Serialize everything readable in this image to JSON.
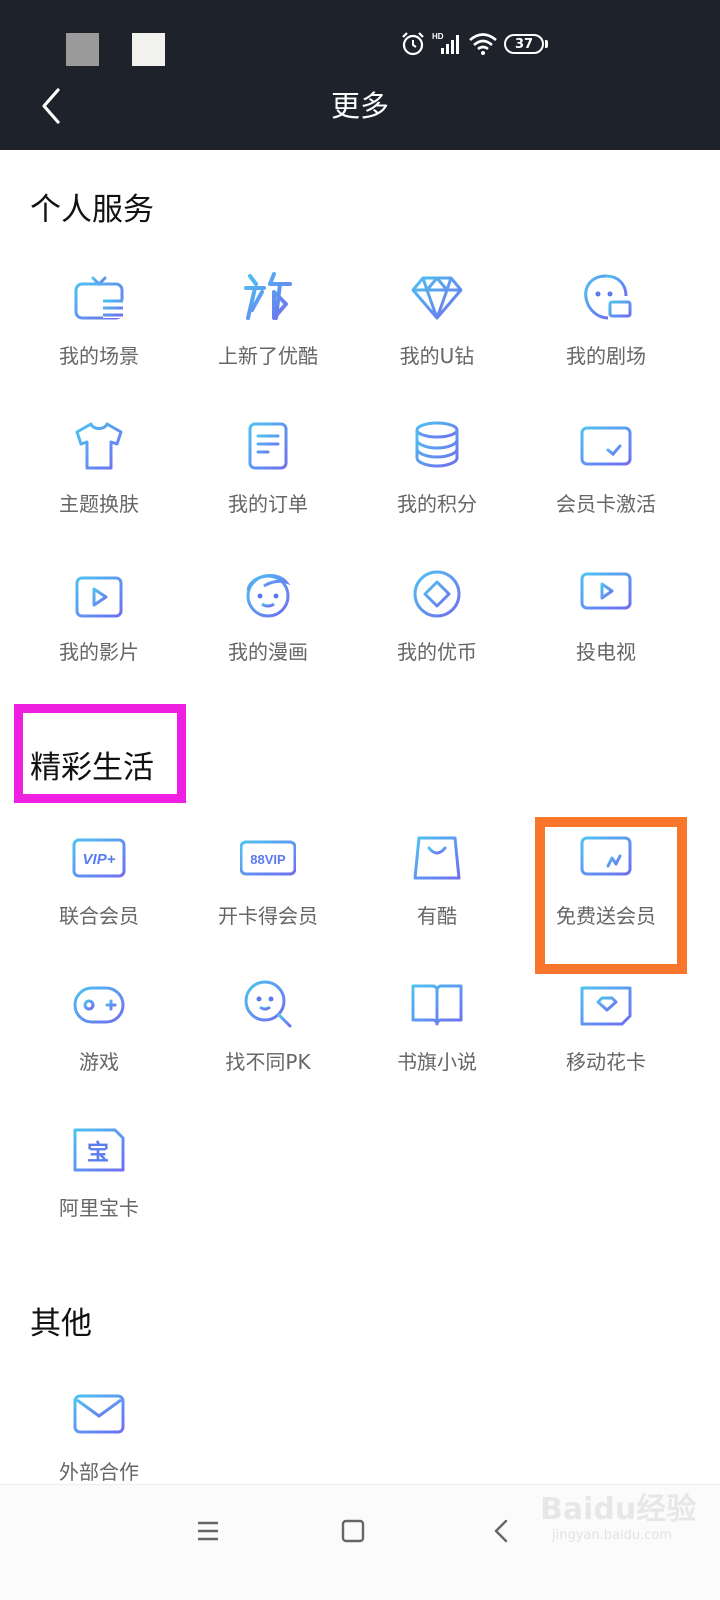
{
  "status_bar": {
    "battery": "37",
    "network": "HD"
  },
  "header": {
    "title": "更多"
  },
  "sections": [
    {
      "title": "个人服务",
      "items": [
        {
          "label": "我的场景",
          "icon": "tv-list-icon"
        },
        {
          "label": "上新了优酷",
          "icon": "new-icon"
        },
        {
          "label": "我的U钻",
          "icon": "diamond-icon"
        },
        {
          "label": "我的剧场",
          "icon": "theater-icon"
        },
        {
          "label": "主题换肤",
          "icon": "tshirt-icon"
        },
        {
          "label": "我的订单",
          "icon": "order-icon"
        },
        {
          "label": "我的积分",
          "icon": "coins-icon"
        },
        {
          "label": "会员卡激活",
          "icon": "card-check-icon"
        },
        {
          "label": "我的影片",
          "icon": "film-icon"
        },
        {
          "label": "我的漫画",
          "icon": "comic-face-icon"
        },
        {
          "label": "我的优币",
          "icon": "coin-icon"
        },
        {
          "label": "投电视",
          "icon": "cast-tv-icon"
        }
      ]
    },
    {
      "title": "精彩生活",
      "items": [
        {
          "label": "联合会员",
          "icon": "vip-plus-icon",
          "icon_text": "VIP+"
        },
        {
          "label": "开卡得会员",
          "icon": "88vip-icon",
          "icon_text": "88VIP"
        },
        {
          "label": "有酷",
          "icon": "shopping-bag-icon"
        },
        {
          "label": "免费送会员",
          "icon": "card-gift-icon"
        },
        {
          "label": "游戏",
          "icon": "gamepad-icon"
        },
        {
          "label": "找不同PK",
          "icon": "search-face-icon"
        },
        {
          "label": "书旗小说",
          "icon": "book-icon"
        },
        {
          "label": "移动花卡",
          "icon": "sim-card-icon"
        },
        {
          "label": "阿里宝卡",
          "icon": "bao-card-icon",
          "icon_text": "宝"
        }
      ]
    },
    {
      "title": "其他",
      "items": [
        {
          "label": "外部合作",
          "icon": "mail-icon"
        }
      ]
    }
  ],
  "bottom_nav": [
    "menu-nav",
    "home-nav",
    "back-nav"
  ],
  "watermark": {
    "main": "Baidu经验",
    "sub": "jingyan.baidu.com"
  },
  "colors": {
    "header_bg": "#1e222b",
    "icon_blue": "#5a7bf0",
    "icon_cyan": "#4ec2f0",
    "highlight_magenta": "#ee1fe0",
    "highlight_orange": "#f7762b"
  }
}
